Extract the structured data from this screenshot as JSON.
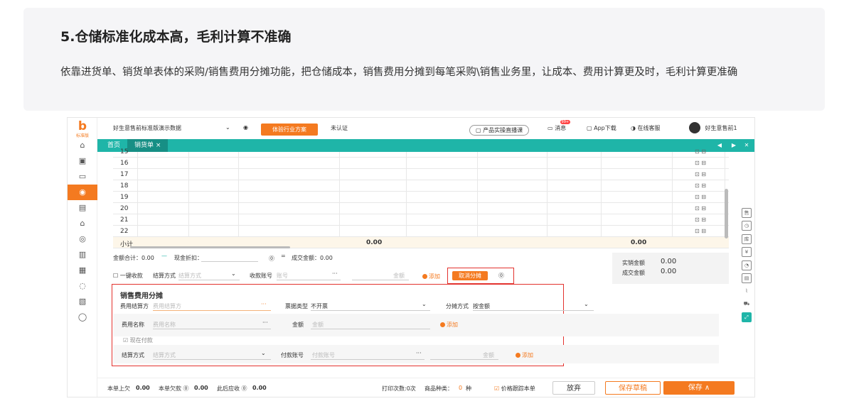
{
  "banner": {
    "title": "5.仓储标准化成本高，毛利计算不准确",
    "desc": "依靠进货单、销货单表体的采购/销售费用分摊功能，把仓储成本，销售费用分摊到每笔采购\\销售业务里，让成本、费用计算更及时，毛利计算更准确"
  },
  "app": {
    "logo_text": "标准版",
    "topbar": {
      "account": "好生意售前标准版演示数据",
      "industry_btn": "体验行业方案",
      "cert": "未认证",
      "live": "产品实操直播课",
      "msg": "消息",
      "msg_badge": "99+",
      "app_dl": "App下载",
      "service": "在线客服",
      "user": "好生意售前1"
    },
    "tabs": {
      "home": "首页",
      "current": "销货单 ×"
    },
    "grid": {
      "rows": [
        "15",
        "16",
        "17",
        "18",
        "19",
        "20",
        "21",
        "22"
      ],
      "subtotal_label": "小计",
      "subtotal_a": "0.00",
      "subtotal_b": "0.00"
    },
    "totals": {
      "amount": "金额合计：0.00",
      "discount": "现金折扣：",
      "deal": "成交金额：0.00",
      "actual_label": "实销金额",
      "actual_val": "0.00",
      "deal_label": "成交金额",
      "deal_val": "0.00"
    },
    "collect": {
      "one_click": "一键收款",
      "method_label": "结算方式",
      "method_ph": "结算方式",
      "account_label": "收款账号",
      "account_ph": "账号",
      "amount_ph": "金额",
      "add": "添加",
      "cancel_alloc": "取消分摊",
      "help": "?"
    },
    "fee": {
      "title": "销售费用分摊",
      "settle_label": "费用结算方",
      "settle_ph": "费用结算方",
      "invoice_label": "票据类型",
      "invoice_val": "不开票",
      "method_label": "分摊方式",
      "method_val": "按金额",
      "name_label": "费用名称",
      "name_ph": "费用名称",
      "amount_label": "金额",
      "amount_ph": "金额",
      "add": "添加",
      "pay_now": "现在付款",
      "pay_method_label": "结算方式",
      "pay_method_ph": "结算方式",
      "pay_acct_label": "付款账号",
      "pay_acct_ph": "付款账号",
      "pay_amount_ph": "金额",
      "pay_add": "添加"
    },
    "footer": {
      "prev_debt_label": "本单上欠",
      "prev_debt": "0.00",
      "this_debt_label": "本单欠款",
      "this_debt": "0.00",
      "after_label": "此后应收",
      "after": "0.00",
      "print": "打印次数:0次",
      "kinds_label": "商品种类：",
      "kinds": "0",
      "kinds_unit": "种",
      "track": "价格跟踪本单",
      "discard": "放弃",
      "draft": "保存草稿",
      "save": "保存 ∧"
    },
    "colors": {
      "accent": "#f47a20",
      "teal": "#1fb5a8",
      "red": "#e3322e"
    }
  }
}
